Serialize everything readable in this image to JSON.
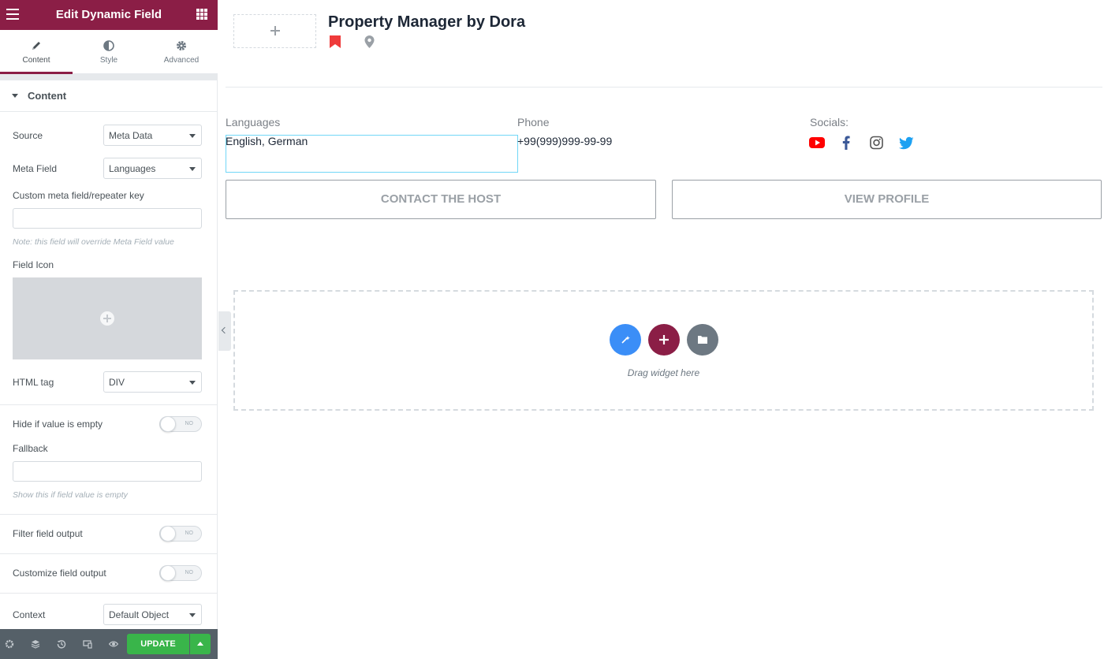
{
  "sidebar": {
    "header": {
      "title": "Edit Dynamic Field"
    },
    "tabs": [
      {
        "label": "Content",
        "icon": "pencil-icon",
        "active": true
      },
      {
        "label": "Style",
        "icon": "half-circle-icon",
        "active": false
      },
      {
        "label": "Advanced",
        "icon": "gear-icon",
        "active": false
      }
    ],
    "section": {
      "title": "Content"
    },
    "source": {
      "label": "Source",
      "value": "Meta Data"
    },
    "meta_field": {
      "label": "Meta Field",
      "value": "Languages"
    },
    "custom_key": {
      "label": "Custom meta field/repeater key",
      "value": "",
      "note": "Note: this field will override Meta Field value"
    },
    "field_icon": {
      "label": "Field Icon"
    },
    "html_tag": {
      "label": "HTML tag",
      "value": "DIV"
    },
    "hide_empty": {
      "label": "Hide if value is empty",
      "state": "NO"
    },
    "fallback": {
      "label": "Fallback",
      "value": "",
      "note": "Show this if field value is empty"
    },
    "filter_output": {
      "label": "Filter field output",
      "state": "NO"
    },
    "customize_output": {
      "label": "Customize field output",
      "state": "NO"
    },
    "context": {
      "label": "Context",
      "value": "Default Object"
    },
    "footer": {
      "update_label": "UPDATE"
    }
  },
  "canvas": {
    "title": "Property Manager by Dora",
    "languages": {
      "label": "Languages",
      "value": "English, German"
    },
    "phone": {
      "label": "Phone",
      "value": "+99(999)999-99-99"
    },
    "socials": {
      "label": "Socials:",
      "icons": [
        "youtube-icon",
        "facebook-icon",
        "instagram-icon",
        "twitter-icon"
      ]
    },
    "buttons": {
      "contact": "CONTACT THE HOST",
      "profile": "VIEW PROFILE"
    },
    "drop_zone": {
      "text": "Drag widget here"
    }
  },
  "colors": {
    "brand": "#8b1e46",
    "update": "#39b54a",
    "youtube": "#ff0000",
    "facebook": "#3b5998",
    "twitter": "#1da1f2"
  }
}
